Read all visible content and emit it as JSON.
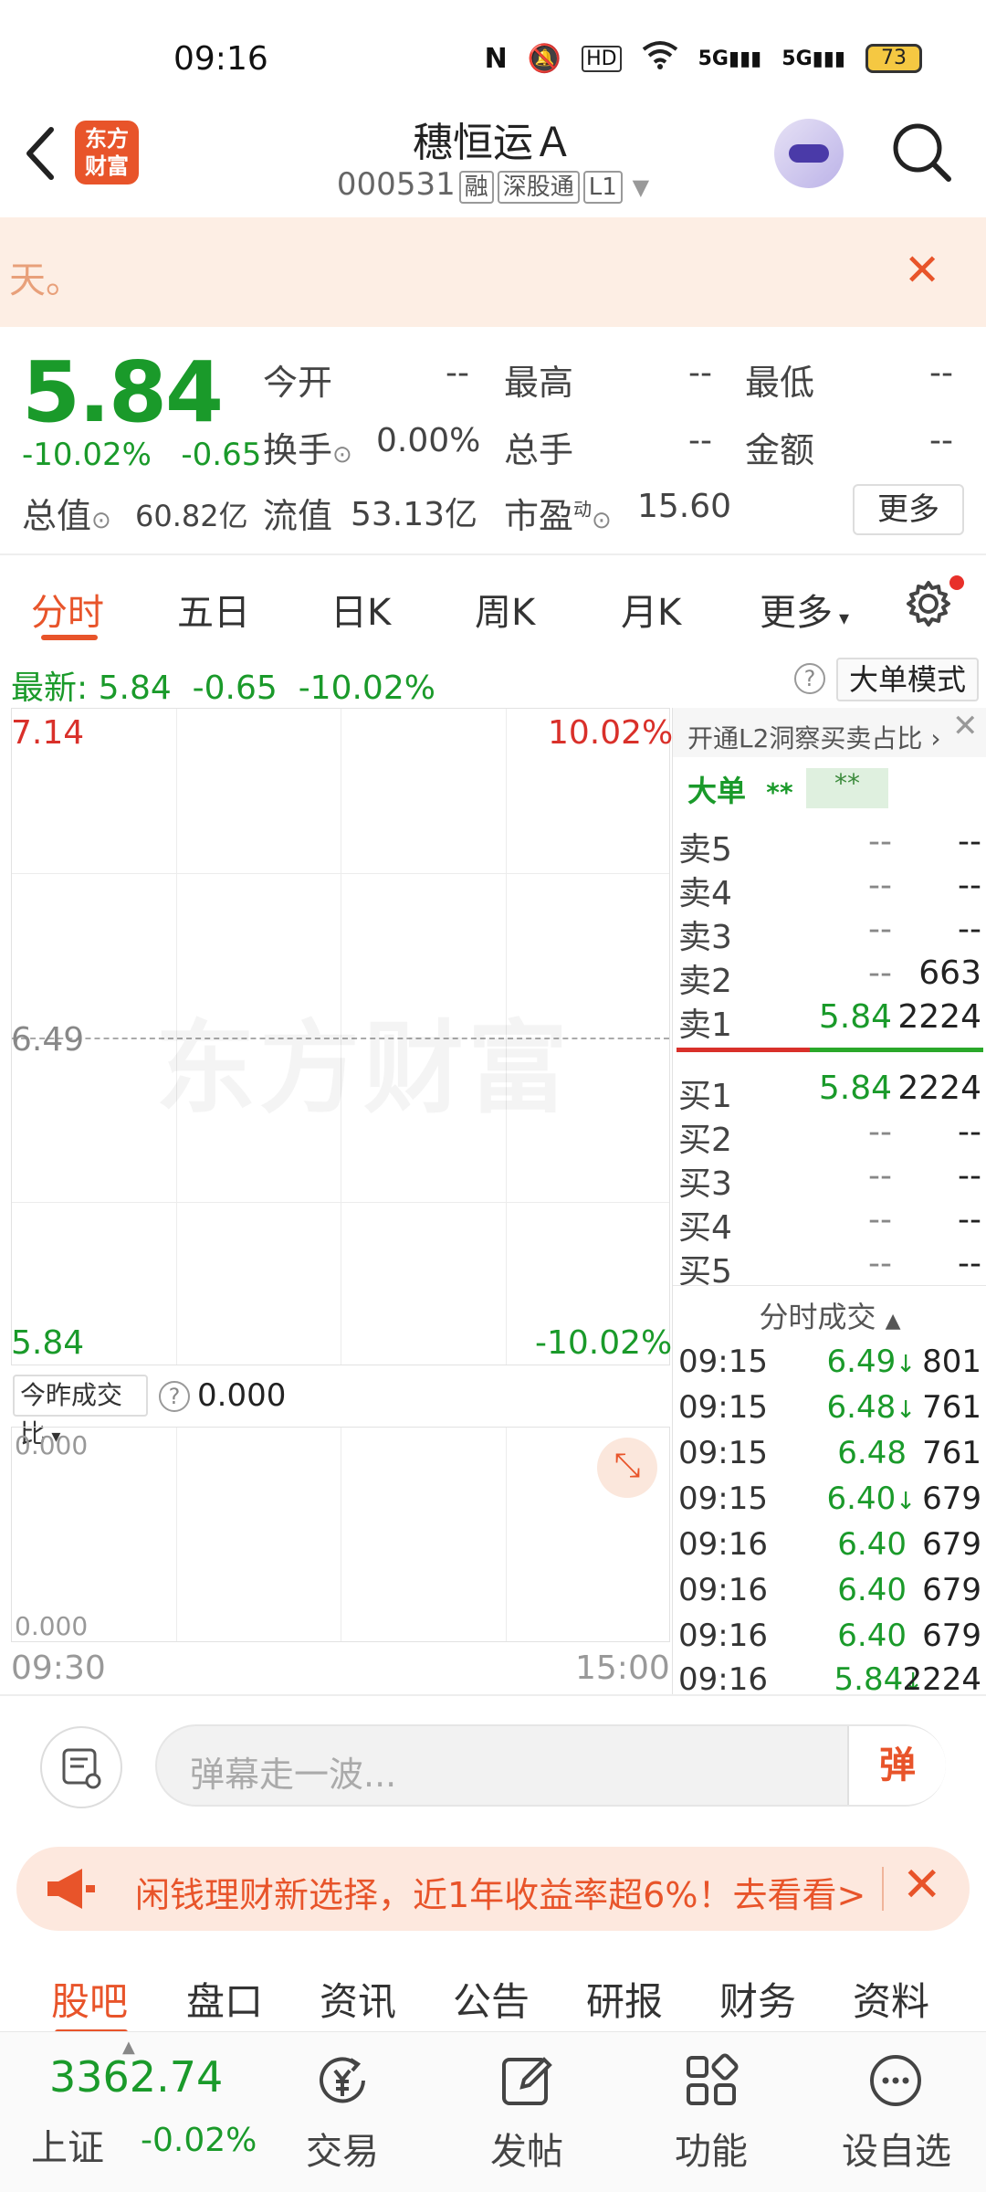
{
  "status_bar": {
    "time": "09:16",
    "nfc": "N",
    "hd": "HD",
    "net1": "5G",
    "net2": "5G",
    "battery": "73"
  },
  "header": {
    "logo_text": "东方\n财富",
    "stock_name": "穗恒运Ａ",
    "stock_code": "000531",
    "tags": [
      "融",
      "深股通",
      "L1"
    ]
  },
  "notice": {
    "text": "天。"
  },
  "quote": {
    "price": "5.84",
    "change_pct": "-10.02%",
    "change": "-0.65",
    "fields": [
      {
        "label": "今开",
        "value": "--"
      },
      {
        "label": "最高",
        "value": "--"
      },
      {
        "label": "最低",
        "value": "--"
      },
      {
        "label": "换手",
        "value": "0.00%"
      },
      {
        "label": "总手",
        "value": "--"
      },
      {
        "label": "金额",
        "value": "--"
      }
    ],
    "total_value_label": "总值",
    "total_value": "60.82亿",
    "float_value_label": "流值",
    "float_value": "53.13亿",
    "pe_label": "市盈",
    "pe_sup": "动",
    "pe_value": "15.60",
    "more_label": "更多"
  },
  "tabs": [
    "分时",
    "五日",
    "日K",
    "周K",
    "月K",
    "更多"
  ],
  "latest": {
    "label": "最新:",
    "price": "5.84",
    "change": "-0.65",
    "pct": "-10.02%",
    "help": "?",
    "mode_button": "大单模式"
  },
  "chart": {
    "y_top": "7.14",
    "y_mid": "6.49",
    "y_bottom": "5.84",
    "pct_top": "10.02%",
    "pct_bottom": "-10.02%",
    "watermark": "东方财富",
    "vol_selector": "今昨成交比",
    "vol_value": "0.000",
    "vol_top": "0.000",
    "vol_bottom": "0.000",
    "time_start": "09:30",
    "time_end": "15:00"
  },
  "book": {
    "l2_banner": "开通L2洞察买卖占比",
    "big_order_label": "大单",
    "big_order_val1": "**",
    "big_order_val2": "**",
    "asks": [
      {
        "name": "卖5",
        "price": "--",
        "vol": "--"
      },
      {
        "name": "卖4",
        "price": "--",
        "vol": "--"
      },
      {
        "name": "卖3",
        "price": "--",
        "vol": "--"
      },
      {
        "name": "卖2",
        "price": "--",
        "vol": "663"
      },
      {
        "name": "卖1",
        "price": "5.84",
        "vol": "2224"
      }
    ],
    "bids": [
      {
        "name": "买1",
        "price": "5.84",
        "vol": "2224"
      },
      {
        "name": "买2",
        "price": "--",
        "vol": "--"
      },
      {
        "name": "买3",
        "price": "--",
        "vol": "--"
      },
      {
        "name": "买4",
        "price": "--",
        "vol": "--"
      },
      {
        "name": "买5",
        "price": "--",
        "vol": "--"
      }
    ],
    "ticks_title": "分时成交",
    "ticks": [
      {
        "time": "09:15",
        "price": "6.49",
        "arrow": "↓",
        "vol": "801"
      },
      {
        "time": "09:15",
        "price": "6.48",
        "arrow": "↓",
        "vol": "761"
      },
      {
        "time": "09:15",
        "price": "6.48",
        "arrow": "",
        "vol": "761"
      },
      {
        "time": "09:15",
        "price": "6.40",
        "arrow": "↓",
        "vol": "679"
      },
      {
        "time": "09:16",
        "price": "6.40",
        "arrow": "",
        "vol": "679"
      },
      {
        "time": "09:16",
        "price": "6.40",
        "arrow": "",
        "vol": "679"
      },
      {
        "time": "09:16",
        "price": "6.40",
        "arrow": "",
        "vol": "679"
      },
      {
        "time": "09:16",
        "price": "5.84",
        "arrow": "↓",
        "vol": "2224"
      }
    ]
  },
  "danmu": {
    "placeholder": "弹幕走一波...",
    "send": "弹"
  },
  "ad": {
    "text": "闲钱理财新选择，近1年收益率超6%！去看看>"
  },
  "bottom_tabs": [
    "股吧",
    "盘口",
    "资讯",
    "公告",
    "研报",
    "财务",
    "资料"
  ],
  "bottom_bar": {
    "index_value": "3362.74",
    "index_name": "上证",
    "index_change": "-0.02%",
    "items": [
      "交易",
      "发帖",
      "功能",
      "设自选"
    ]
  },
  "colors": {
    "up": "#d9302a",
    "down": "#1a9a2a",
    "accent": "#e8542a"
  }
}
